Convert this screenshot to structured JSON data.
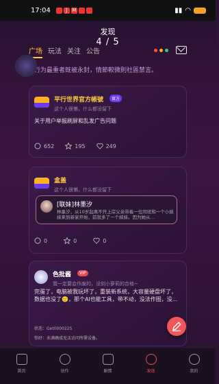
{
  "status": {
    "time": "17:04",
    "app_chips": [
      "",
      "J",
      "M",
      "",
      ""
    ]
  },
  "header": {
    "title": "发现",
    "subtitle": "4 / 5",
    "tabs": [
      "广场",
      "玩法",
      "关注",
      "公告"
    ]
  },
  "notice": "行为最重者既被永封，情節較微則社區禁言。",
  "posts": [
    {
      "author": "平行世界官方帳號",
      "badge": "官方",
      "signature": "这个人很懒，什么都没留下",
      "content": "关于用户举报刷屏和乱发广告问题",
      "comments": "652",
      "stars": "195",
      "likes": "249"
    },
    {
      "author": "盒盖",
      "signature": "这个人很懒，什么都没留下",
      "quote_title": "[联妹]林墨汐",
      "quote_text": "林墨汐，从10岁起离不开上岸父亲带着一位同班和一个小妹妹来到新家开始，前就多了一个妹妹。因为她从…",
      "comments": "0",
      "stars": "0",
      "likes": "0"
    },
    {
      "author": "色批酱",
      "badge": "VIP",
      "signature": "我一定要会作废的，没刻小萝莉的合格~",
      "content": "完蛋了，电脑被我玩坏了，重装新系统，大容量硬盘坏了，数据也没了🙂，那个AI也能工具，带不动，没法作图，没…",
      "extra1": "状态：Get0000225",
      "extra2": "你好：未满确成无法访问所需设备。"
    }
  ],
  "nav": [
    "首页",
    "创作",
    "剧情",
    "发现",
    "我的"
  ]
}
